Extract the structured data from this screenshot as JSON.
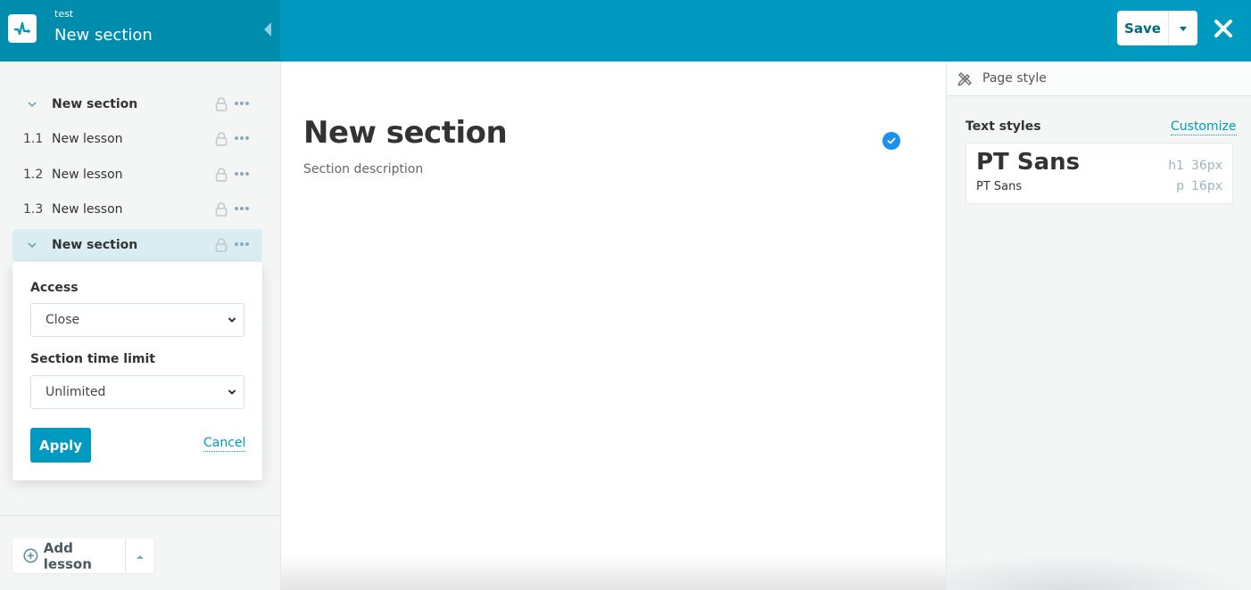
{
  "header": {
    "course_name": "test",
    "section_title": "New section",
    "save_label": "Save",
    "icons": {
      "logo": "pulse-logo-icon",
      "collapse": "triangle-left-icon",
      "save_menu": "caret-down-icon",
      "close": "close-x-icon"
    }
  },
  "sidebar": {
    "items": [
      {
        "type": "section",
        "number": "",
        "label": "New section",
        "active": false
      },
      {
        "type": "lesson",
        "number": "1.1",
        "label": "New lesson",
        "active": false
      },
      {
        "type": "lesson",
        "number": "1.2",
        "label": "New lesson",
        "active": false
      },
      {
        "type": "lesson",
        "number": "1.3",
        "label": "New lesson",
        "active": false
      },
      {
        "type": "section",
        "number": "",
        "label": "New section",
        "active": true
      }
    ],
    "popover": {
      "access_label": "Access",
      "access_value": "Close",
      "time_limit_label": "Section time limit",
      "time_limit_value": "Unlimited",
      "apply_label": "Apply",
      "cancel_label": "Cancel"
    },
    "add_lesson_label": "Add lesson"
  },
  "main": {
    "heading": "New section",
    "description": "Section description",
    "status_icon": "check-circle-icon",
    "status_color": "#1a90f0"
  },
  "right_panel": {
    "header_label": "Page style",
    "text_styles_label": "Text styles",
    "customize_label": "Customize",
    "heading_font": "PT Sans",
    "paragraph_font": "PT Sans",
    "h1_tag": "h1",
    "h1_size": "36px",
    "p_tag": "p",
    "p_size": "16px"
  },
  "colors": {
    "accent": "#0099bf",
    "header_left": "#008cad",
    "active_item": "#d9edf3"
  }
}
